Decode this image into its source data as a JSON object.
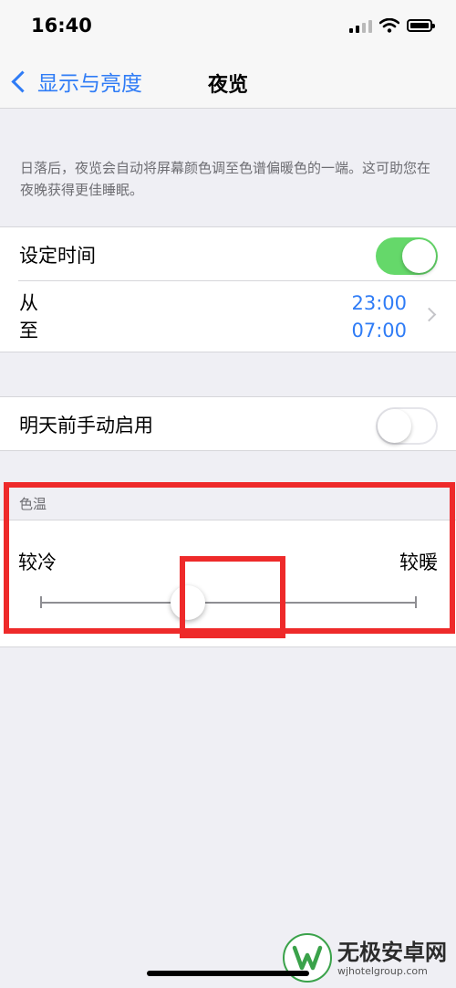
{
  "status": {
    "time": "16:40"
  },
  "nav": {
    "back_label": "显示与亮度",
    "title": "夜览"
  },
  "description": "日落后，夜览会自动将屏幕颜色调至色谱偏暖色的一端。这可助您在夜晚获得更佳睡眠。",
  "schedule": {
    "label": "设定时间",
    "enabled": true,
    "from_label": "从",
    "to_label": "至",
    "from_time": "23:00",
    "to_time": "07:00"
  },
  "manual": {
    "label": "明天前手动启用",
    "enabled": false
  },
  "color_temp": {
    "header": "色温",
    "cool_label": "较冷",
    "warm_label": "较暖",
    "level": 0.5
  },
  "watermark": {
    "brand": "无极安卓网",
    "url": "wjhotelgroup.com"
  },
  "colors": {
    "accent": "#2f7cf6",
    "toggle_on": "#65d86a",
    "highlight": "#ee2a2a",
    "background": "#efeff4"
  },
  "icons": [
    "signal-icon",
    "wifi-icon",
    "battery-icon",
    "back-chevron-icon",
    "chevron-right-icon"
  ]
}
